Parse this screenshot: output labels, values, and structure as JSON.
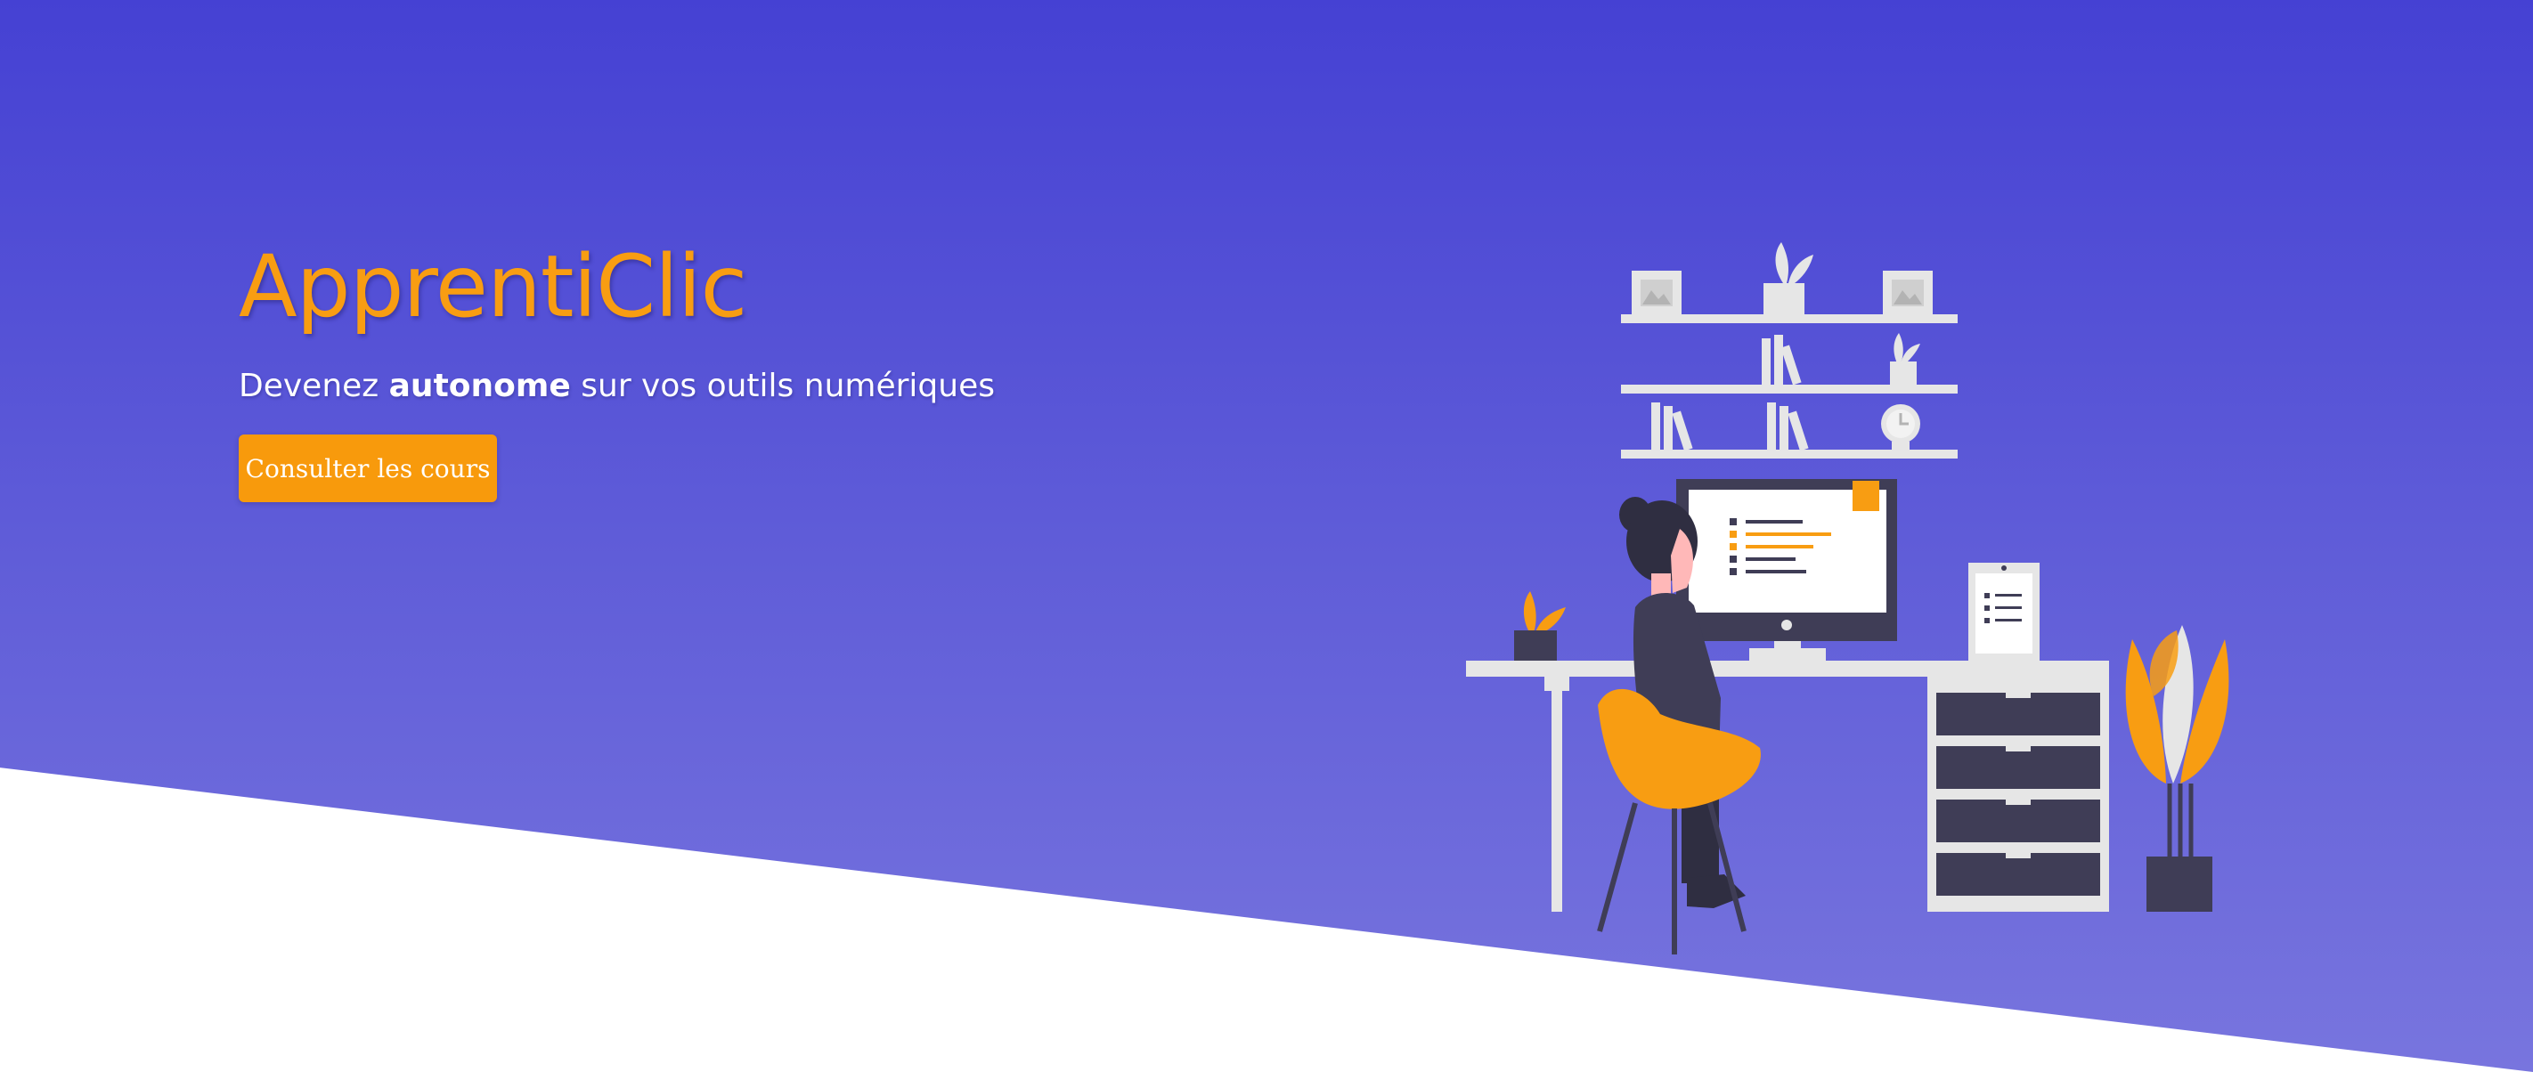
{
  "hero": {
    "title": "ApprentiClic",
    "tagline_before": "Devenez ",
    "tagline_strong": "autonome",
    "tagline_after": " sur vos outils numériques",
    "cta_label": "Consulter les cours"
  },
  "colors": {
    "gradient_top": "#4541d3",
    "gradient_bottom": "#7875de",
    "accent_orange": "#f89d12",
    "white": "#ffffff",
    "furniture_gray": "#e6e6e6",
    "drawer_dark": "#3f3d56"
  },
  "illustration": {
    "subject": "person-working-at-desk-illustration"
  }
}
